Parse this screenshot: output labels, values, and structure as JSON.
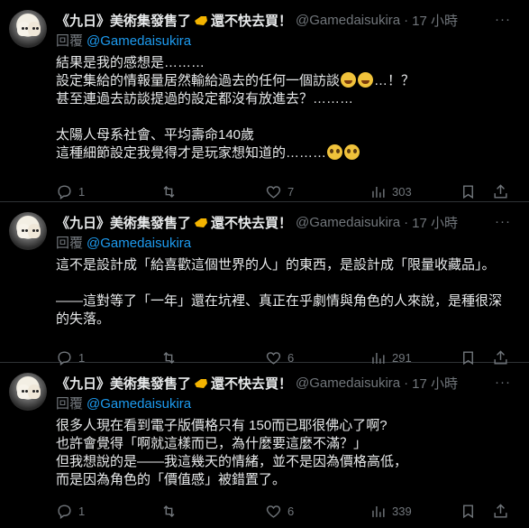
{
  "posts": [
    {
      "author": "《九日》美術集發售了",
      "author_suffix": "還不快去買！",
      "handle": "@Gamedaisukira",
      "dot": "·",
      "time": "17 小時",
      "more": "···",
      "reply_prefix": "回覆",
      "reply_to": "@Gamedaisukira",
      "text_lines": [
        "結果是我的感想是………",
        "設定集給的情報量居然輸給過去的任何一個訪談",
        "…！？",
        "甚至連過去訪談提過的設定都沒有放進去？………",
        "",
        "太陽人母系社會、平均壽命140歲",
        "這種細節設定我覺得才是玩家想知道的………"
      ],
      "replies": "1",
      "retweets": "",
      "likes": "7",
      "views": "303"
    },
    {
      "author": "《九日》美術集發售了",
      "author_suffix": "還不快去買！",
      "handle": "@Gamedaisukira",
      "dot": "·",
      "time": "17 小時",
      "more": "···",
      "reply_prefix": "回覆",
      "reply_to": "@Gamedaisukira",
      "text": "這不是設計成「給喜歡這個世界的人」的東西，是設計成「限量收藏品」。\n\n——這對等了「一年」還在坑裡、真正在乎劇情與角色的人來說，是種很深的失落。",
      "replies": "1",
      "retweets": "",
      "likes": "6",
      "views": "291"
    },
    {
      "author": "《九日》美術集發售了",
      "author_suffix": "還不快去買！",
      "handle": "@Gamedaisukira",
      "dot": "·",
      "time": "17 小時",
      "more": "···",
      "reply_prefix": "回覆",
      "reply_to": "@Gamedaisukira",
      "text": "很多人現在看到電子版價格只有 150而已耶很佛心了啊?\n也許會覺得「啊就這樣而已，為什麼要這麼不滿？」\n但我想說的是——我這幾天的情緒，並不是因為價格高低，\n而是因為角色的「價值感」被錯置了。",
      "replies": "1",
      "retweets": "",
      "likes": "6",
      "views": "339"
    }
  ]
}
